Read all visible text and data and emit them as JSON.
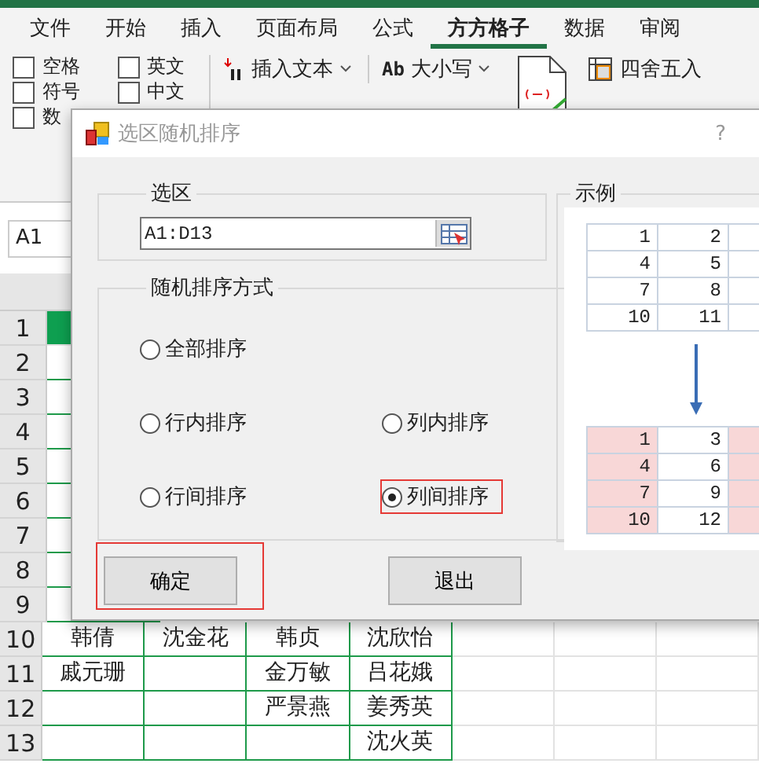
{
  "ribbon": {
    "tabs": [
      {
        "label": "文件",
        "selected": false
      },
      {
        "label": "开始",
        "selected": false
      },
      {
        "label": "插入",
        "selected": false
      },
      {
        "label": "页面布局",
        "selected": false
      },
      {
        "label": "公式",
        "selected": false
      },
      {
        "label": "方方格子",
        "selected": true
      },
      {
        "label": "数据",
        "selected": false
      },
      {
        "label": "审阅",
        "selected": false
      }
    ],
    "checkboxes": [
      {
        "label": "空格",
        "checked": false
      },
      {
        "label": "英文",
        "checked": false
      },
      {
        "label": "符号",
        "checked": false
      },
      {
        "label": "中文",
        "checked": false
      },
      {
        "label": "数",
        "checked": false
      }
    ],
    "commands": [
      {
        "kind": "insert",
        "label": "插入文本"
      },
      {
        "kind": "case",
        "icon_text": "Ab",
        "label": "大小写"
      },
      {
        "kind": "round",
        "label": "四舍五入"
      }
    ]
  },
  "name_box": "A1",
  "sheet": {
    "rows": [
      {
        "number": "1"
      },
      {
        "number": "2"
      },
      {
        "number": "3"
      },
      {
        "number": "4"
      },
      {
        "number": "5"
      },
      {
        "number": "6"
      },
      {
        "number": "7"
      },
      {
        "number": "8"
      },
      {
        "number": "9"
      },
      {
        "number": "10",
        "cells": [
          "韩倩",
          "沈金花",
          "韩贞",
          "沈欣怡"
        ]
      },
      {
        "number": "11",
        "cells": [
          "戚元珊",
          "",
          "金万敏",
          "吕花娥"
        ]
      },
      {
        "number": "12",
        "cells": [
          "",
          "",
          "严景燕",
          "姜秀英"
        ]
      },
      {
        "number": "13",
        "cells": [
          "",
          "",
          "",
          "沈火英"
        ]
      }
    ]
  },
  "dialog": {
    "title": "选区随机排序",
    "help": "?",
    "selection": {
      "legend": "选区",
      "value": "A1:D13"
    },
    "mode": {
      "legend": "随机排序方式",
      "rows": [
        [
          {
            "label": "全部排序",
            "selected": false,
            "highlighted": false
          }
        ],
        [
          {
            "label": "行内排序",
            "selected": false,
            "highlighted": false
          },
          {
            "label": "列内排序",
            "selected": false,
            "highlighted": false
          }
        ],
        [
          {
            "label": "行间排序",
            "selected": false,
            "highlighted": false
          },
          {
            "label": "列间排序",
            "selected": true,
            "highlighted": true
          }
        ]
      ]
    },
    "example": {
      "legend": "示例",
      "before": [
        [
          "1",
          "2"
        ],
        [
          "4",
          "5"
        ],
        [
          "7",
          "8"
        ],
        [
          "10",
          "11"
        ]
      ],
      "after": {
        "columns_highlighted": [
          true,
          false,
          true
        ],
        "rows": [
          [
            "1",
            "3"
          ],
          [
            "4",
            "6"
          ],
          [
            "7",
            "9"
          ],
          [
            "10",
            "12"
          ]
        ]
      }
    },
    "buttons": [
      {
        "label": "确定",
        "highlighted": true
      },
      {
        "label": "退出",
        "highlighted": false
      }
    ]
  }
}
